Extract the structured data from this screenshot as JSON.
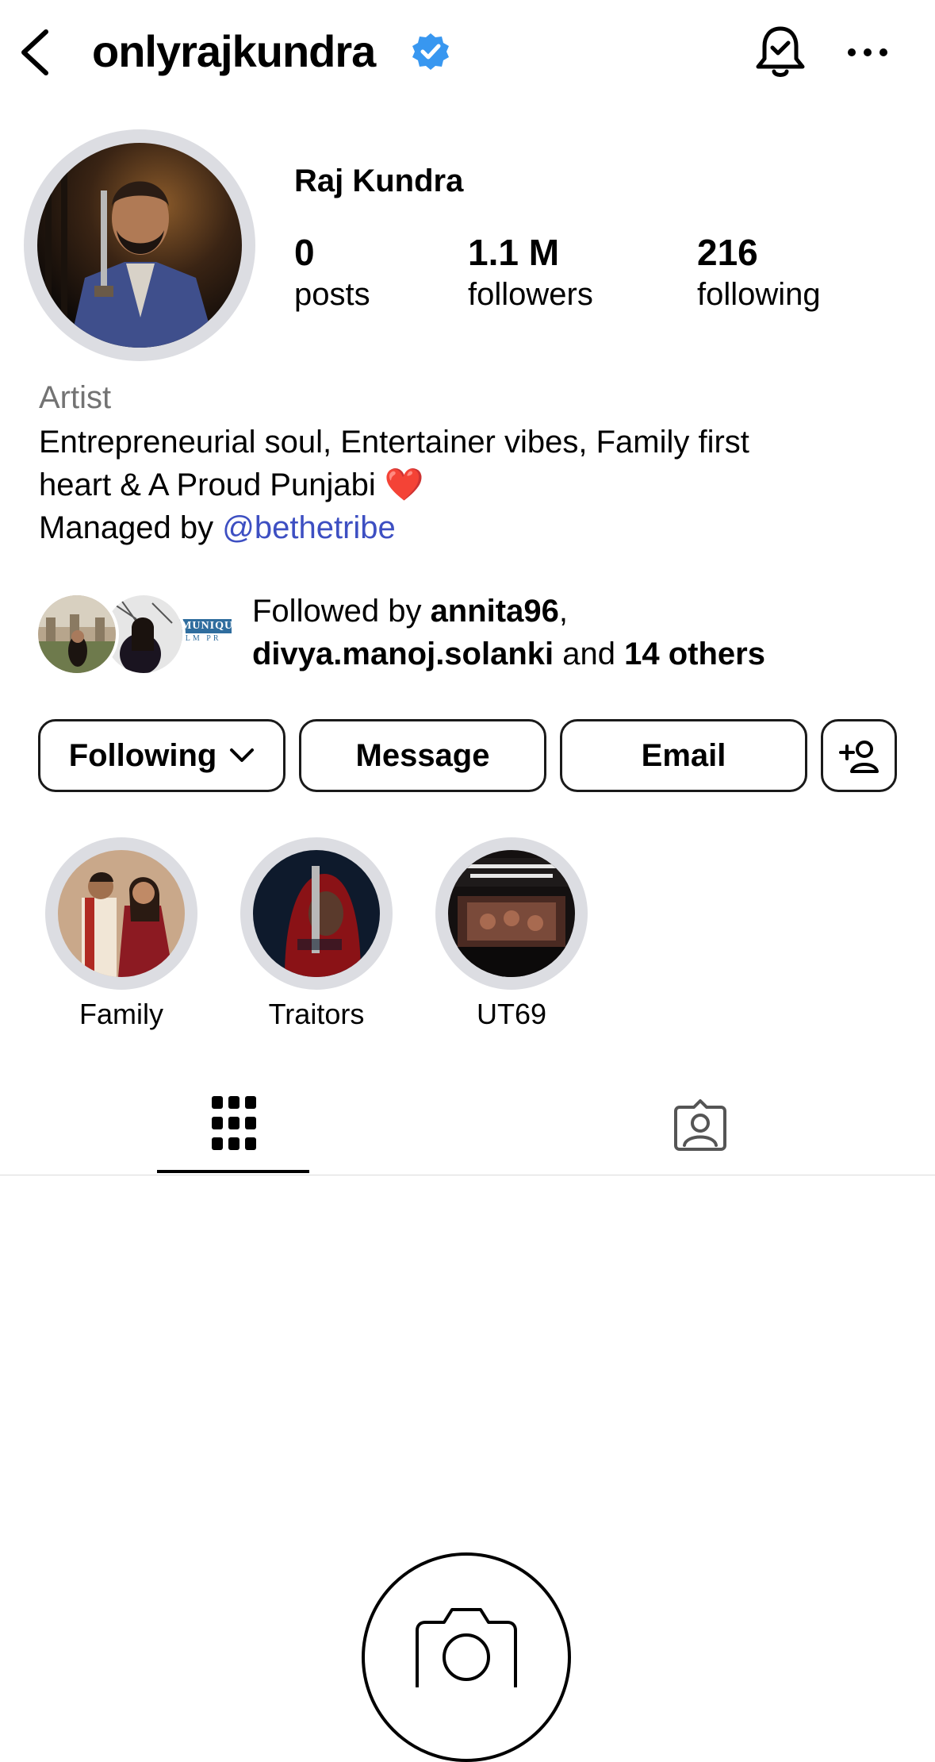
{
  "header": {
    "username": "onlyrajkundra",
    "icons": [
      "back-arrow-icon",
      "verified-badge-icon",
      "bell-check-icon",
      "more-options-icon"
    ]
  },
  "profile": {
    "display_name": "Raj Kundra",
    "stats": {
      "posts": {
        "value": "0",
        "label": "posts"
      },
      "followers": {
        "value": "1.1 M",
        "label": "followers"
      },
      "following": {
        "value": "216",
        "label": "following"
      }
    },
    "category": "Artist",
    "bio": {
      "line1": "Entrepreneurial soul, Entertainer vibes, Family first",
      "line2": "heart & A Proud Punjabi ❤️",
      "line3_prefix": "Managed by ",
      "mention": "@bethetribe"
    }
  },
  "followed_by": {
    "prefix": "Followed by ",
    "user1": "annita96",
    "comma": ",",
    "user2": "divya.manoj.solanki",
    "and": " and ",
    "others": "14 others"
  },
  "buttons": {
    "following": "Following",
    "message": "Message",
    "email": "Email"
  },
  "highlights": [
    {
      "label": "Family"
    },
    {
      "label": "Traitors"
    },
    {
      "label": "UT69"
    }
  ],
  "tabs": [
    "grid-icon",
    "tagged-icon"
  ],
  "colors": {
    "verified": "#3897f0",
    "mention": "#3d4fc2",
    "secondary_text": "#737373",
    "ring": "#dcdde2"
  }
}
